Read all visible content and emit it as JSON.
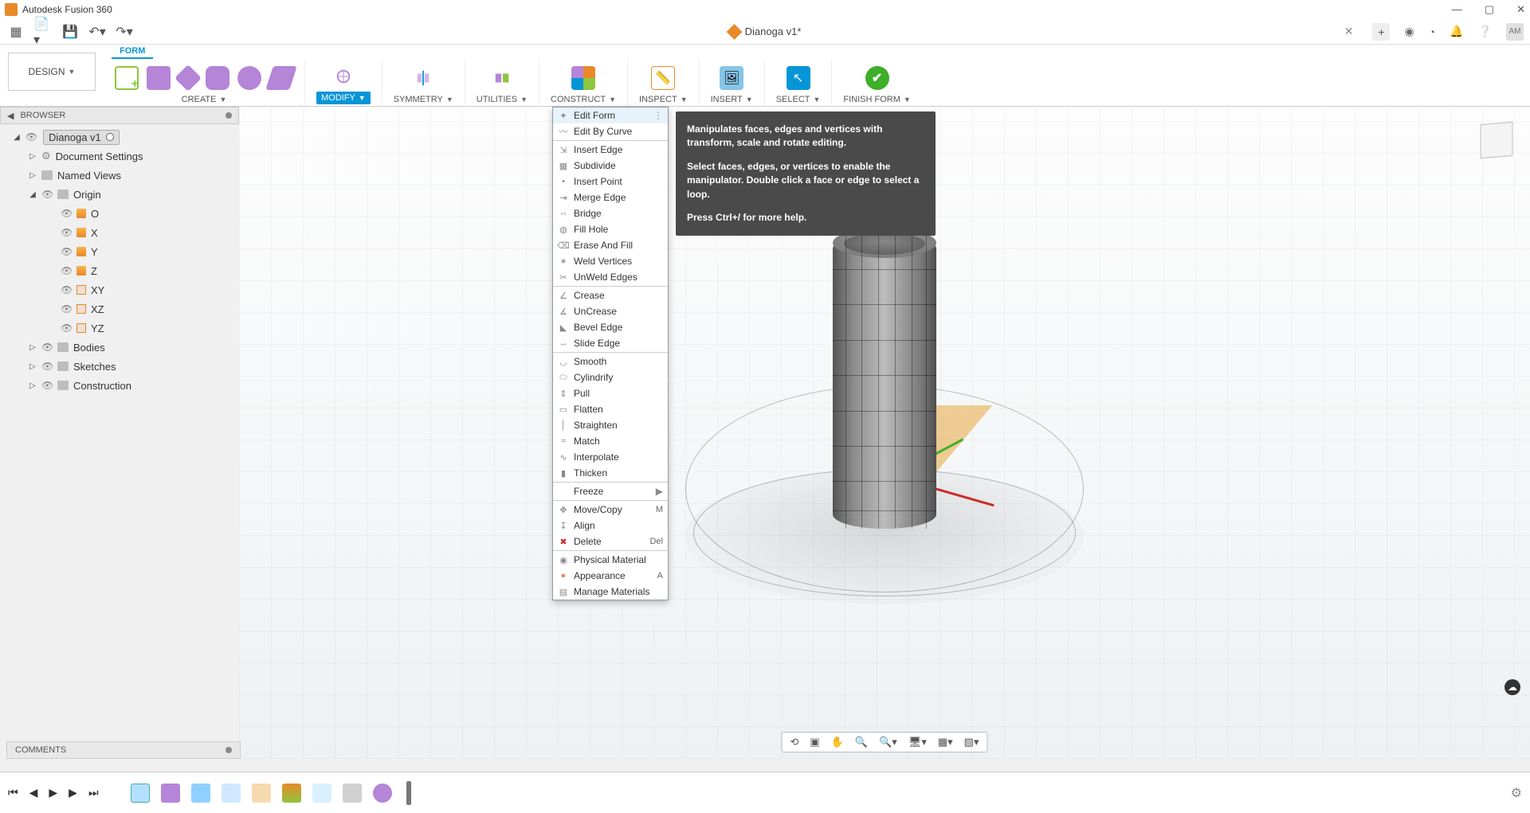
{
  "window": {
    "title": "Autodesk Fusion 360"
  },
  "document": {
    "tab_title": "Dianoga v1*",
    "avatar_initials": "AM"
  },
  "tabs": {
    "form": "FORM"
  },
  "workspace": {
    "design": "DESIGN"
  },
  "ribbon": {
    "create": "CREATE",
    "modify": "MODIFY",
    "symmetry": "SYMMETRY",
    "utilities": "UTILITIES",
    "construct": "CONSTRUCT",
    "inspect": "INSPECT",
    "insert": "INSERT",
    "select": "SELECT",
    "finish_form": "FINISH FORM"
  },
  "browser": {
    "title": "BROWSER",
    "root": "Dianoga v1",
    "doc_settings": "Document Settings",
    "named_views": "Named Views",
    "origin": "Origin",
    "axes": {
      "o": "O",
      "x": "X",
      "y": "Y",
      "z": "Z",
      "xy": "XY",
      "xz": "XZ",
      "yz": "YZ"
    },
    "bodies": "Bodies",
    "sketches": "Sketches",
    "construction": "Construction"
  },
  "modify_menu": {
    "edit_form": "Edit Form",
    "edit_by_curve": "Edit By Curve",
    "insert_edge": "Insert Edge",
    "subdivide": "Subdivide",
    "insert_point": "Insert Point",
    "merge_edge": "Merge Edge",
    "bridge": "Bridge",
    "fill_hole": "Fill Hole",
    "erase_and_fill": "Erase And Fill",
    "weld_vertices": "Weld Vertices",
    "unweld_edges": "UnWeld Edges",
    "crease": "Crease",
    "uncrease": "UnCrease",
    "bevel_edge": "Bevel Edge",
    "slide_edge": "Slide Edge",
    "smooth": "Smooth",
    "cylindrify": "Cylindrify",
    "pull": "Pull",
    "flatten": "Flatten",
    "straighten": "Straighten",
    "match": "Match",
    "interpolate": "Interpolate",
    "thicken": "Thicken",
    "freeze": "Freeze",
    "move_copy": "Move/Copy",
    "move_copy_sc": "M",
    "align": "Align",
    "delete": "Delete",
    "delete_sc": "Del",
    "physical_material": "Physical Material",
    "appearance": "Appearance",
    "appearance_sc": "A",
    "manage_materials": "Manage Materials"
  },
  "tooltip": {
    "p1": "Manipulates faces, edges and vertices with transform, scale and rotate editing.",
    "p2": "Select faces, edges, or vertices to enable the manipulator. Double click a face or edge to select a loop.",
    "p3": "Press Ctrl+/ for more help."
  },
  "comments": {
    "title": "COMMENTS"
  }
}
